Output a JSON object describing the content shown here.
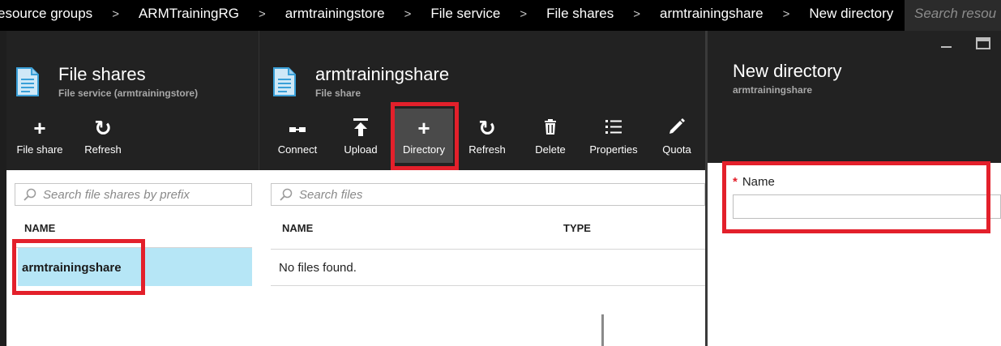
{
  "breadcrumb": {
    "items": [
      "esource groups",
      "ARMTrainingRG",
      "armtrainingstore",
      "File service",
      "File shares",
      "armtrainingshare",
      "New directory"
    ],
    "separator": ">"
  },
  "global_search": {
    "placeholder": "Search resou"
  },
  "blade_file_shares": {
    "title": "File shares",
    "subtitle": "File service (armtrainingstore)",
    "icon": "document-icon",
    "commands": [
      {
        "label": "File share",
        "icon": "plus-icon"
      },
      {
        "label": "Refresh",
        "icon": "refresh-icon"
      }
    ],
    "search_placeholder": "Search file shares by prefix",
    "column_name": "NAME",
    "rows": [
      "armtrainingshare"
    ]
  },
  "blade_share": {
    "title": "armtrainingshare",
    "subtitle": "File share",
    "icon": "document-icon",
    "commands": [
      {
        "label": "Connect",
        "icon": "connect-icon"
      },
      {
        "label": "Upload",
        "icon": "upload-icon"
      },
      {
        "label": "Directory",
        "icon": "plus-icon"
      },
      {
        "label": "Refresh",
        "icon": "refresh-icon"
      },
      {
        "label": "Delete",
        "icon": "trash-icon"
      },
      {
        "label": "Properties",
        "icon": "list-icon"
      },
      {
        "label": "Quota",
        "icon": "pencil-icon"
      }
    ],
    "search_placeholder": "Search files",
    "columns": [
      "NAME",
      "TYPE"
    ],
    "empty_message": "No files found."
  },
  "blade_new_directory": {
    "title": "New directory",
    "subtitle": "armtrainingshare",
    "field_label": "Name",
    "required_marker": "*",
    "field_value": ""
  },
  "colors": {
    "chrome_dark": "#222222",
    "topbar": "#000000",
    "highlight_red": "#e3202b",
    "selected_row": "#b6e6f6",
    "active_command": "#4a4a4a"
  }
}
